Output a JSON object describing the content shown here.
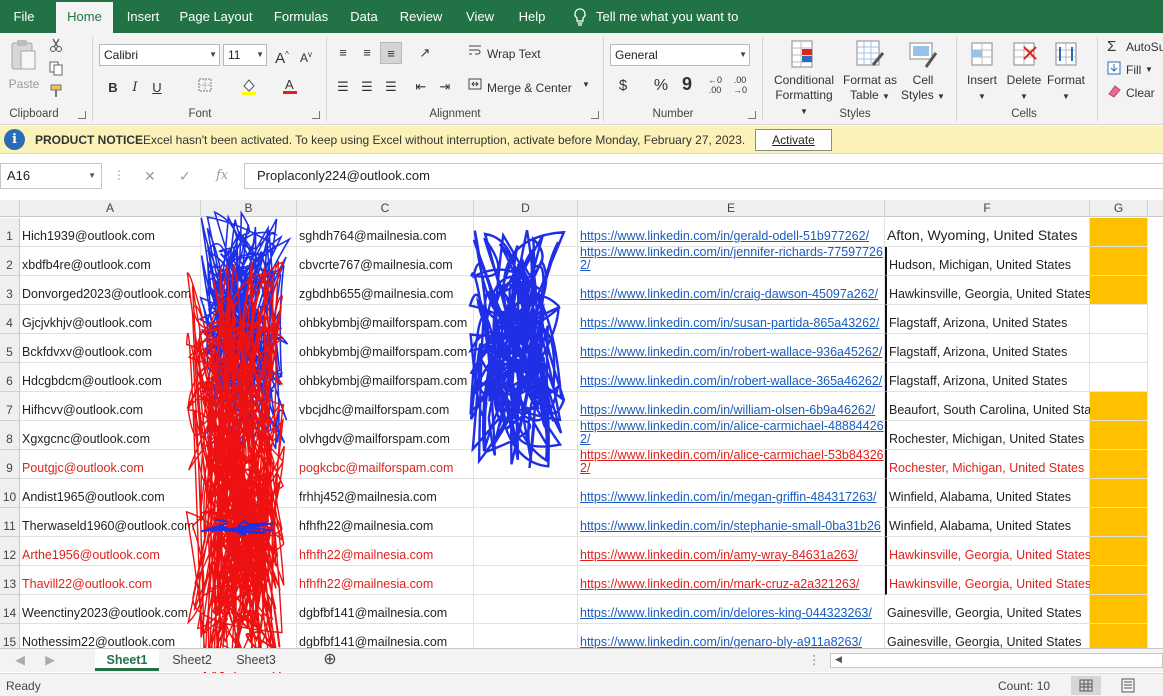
{
  "ribbon_tabs": [
    "File",
    "Home",
    "Insert",
    "Page Layout",
    "Formulas",
    "Data",
    "Review",
    "View",
    "Help"
  ],
  "active_tab": "Home",
  "tell_me": "Tell me what you want to do",
  "clipboard": {
    "paste": "Paste",
    "group": "Clipboard"
  },
  "font": {
    "name": "Calibri",
    "size": "11",
    "bold": "B",
    "italic": "I",
    "underline": "U",
    "group": "Font",
    "grow": "A",
    "shrink": "A"
  },
  "alignment": {
    "wrap_text": "Wrap Text",
    "merge_center": "Merge & Center",
    "group": "Alignment"
  },
  "number": {
    "format": "General",
    "currency": "$",
    "percent": "%",
    "comma": "9",
    "group": "Number"
  },
  "styles": {
    "conditional": [
      "Conditional",
      "Formatting"
    ],
    "format_table": [
      "Format as",
      "Table"
    ],
    "cell_styles": [
      "Cell",
      "Styles"
    ],
    "group": "Styles"
  },
  "cells": {
    "insert": "Insert",
    "delete": "Delete",
    "format": "Format",
    "group": "Cells"
  },
  "editing": {
    "autosum": "AutoSu",
    "fill": "Fill",
    "clear": "Clear"
  },
  "notice": {
    "title": "PRODUCT NOTICE",
    "message": "Excel hasn't been activated. To keep using Excel without interruption, activate before Monday, February 27, 2023.",
    "button": "Activate"
  },
  "formula_bar": {
    "cell_ref": "A16",
    "value": "Proplaconly224@outlook.com"
  },
  "columns": [
    "A",
    "B",
    "C",
    "D",
    "E",
    "F",
    "G"
  ],
  "rows": [
    {
      "n": "1",
      "a": "Hich1939@outlook.com",
      "c": "sghdh764@mailnesia.com",
      "e": "https://www.linkedin.com/in/gerald-odell-51b977262/",
      "f": "Afton, Wyoming, United States",
      "red": false,
      "g_fill": true
    },
    {
      "n": "2",
      "a": "xbdfb4re@outlook.com",
      "c": "cbvcrte767@mailnesia.com",
      "e": "https://www.linkedin.com/in/jennifer-richards-775977262/",
      "f": "Hudson, Michigan, United States",
      "red": false,
      "g_fill": true
    },
    {
      "n": "3",
      "a": "Donvorged2023@outlook.com",
      "c": "zgbdhb655@mailnesia.com",
      "e": "https://www.linkedin.com/in/craig-dawson-45097a262/",
      "f": "Hawkinsville, Georgia, United States",
      "red": false,
      "g_fill": true
    },
    {
      "n": "4",
      "a": "Gjcjvkhjv@outlook.com",
      "c": "ohbkybmbj@mailforspam.com",
      "e": "https://www.linkedin.com/in/susan-partida-865a43262/",
      "f": "Flagstaff, Arizona, United States",
      "red": false,
      "g_fill": false
    },
    {
      "n": "5",
      "a": "Bckfdvxv@outlook.com",
      "c": "ohbkybmbj@mailforspam.com",
      "e": "https://www.linkedin.com/in/robert-wallace-936a45262/",
      "f": "Flagstaff, Arizona, United States",
      "red": false,
      "g_fill": false
    },
    {
      "n": "6",
      "a": "Hdcgbdcm@outlook.com",
      "c": "ohbkybmbj@mailforspam.com",
      "e": "https://www.linkedin.com/in/robert-wallace-365a46262/",
      "f": "Flagstaff, Arizona, United States",
      "red": false,
      "g_fill": false
    },
    {
      "n": "7",
      "a": "Hifhcvv@outlook.com",
      "c": "vbcjdhc@mailforspam.com",
      "e": "https://www.linkedin.com/in/william-olsen-6b9a46262/",
      "f": "Beaufort, South Carolina, United States",
      "red": false,
      "g_fill": true
    },
    {
      "n": "8",
      "a": "Xgxgcnc@outlook.com",
      "c": "olvhgdv@mailforspam.com",
      "e": "https://www.linkedin.com/in/alice-carmichael-488844262/",
      "f": "Rochester, Michigan, United States",
      "red": false,
      "g_fill": true
    },
    {
      "n": "9",
      "a": "Poutgjc@outlook.com",
      "c": "pogkcbc@mailforspam.com",
      "e": "https://www.linkedin.com/in/alice-carmichael-53b843262/",
      "f": "Rochester, Michigan, United States",
      "red": true,
      "g_fill": true
    },
    {
      "n": "10",
      "a": "Andist1965@outlook.com",
      "c": "frhhj452@mailnesia.com",
      "e": "https://www.linkedin.com/in/megan-griffin-484317263/",
      "f": "Winfield, Alabama, United States",
      "red": false,
      "g_fill": true
    },
    {
      "n": "11",
      "a": "Therwaseld1960@outlook.com",
      "c": "hfhfh22@mailnesia.com",
      "e": "https://www.linkedin.com/in/stephanie-small-0ba31b26",
      "f": "Winfield, Alabama, United States",
      "red": false,
      "g_fill": true
    },
    {
      "n": "12",
      "a": "Arthe1956@outlook.com",
      "c": "hfhfh22@mailnesia.com",
      "e": "https://www.linkedin.com/in/amy-wray-84631a263/",
      "f": "Hawkinsville, Georgia, United States",
      "red": true,
      "g_fill": true
    },
    {
      "n": "13",
      "a": "Thavill22@outlook.com",
      "c": "hfhfh22@mailnesia.com",
      "e": "https://www.linkedin.com/in/mark-cruz-a2a321263/",
      "f": "Hawkinsville, Georgia, United States",
      "red": true,
      "g_fill": true
    },
    {
      "n": "14",
      "a": "Weenctiny2023@outlook.com",
      "c": "dgbfbf141@mailnesia.com",
      "e": "https://www.linkedin.com/in/delores-king-044323263/",
      "f": "Gainesville, Georgia, United States",
      "red": false,
      "g_fill": true
    },
    {
      "n": "15",
      "a": "Nothessim22@outlook.com",
      "c": "dgbfbf141@mailnesia.com",
      "e": "https://www.linkedin.com/in/genaro-bly-a911a8263/",
      "f": "Gainesville, Georgia, United States",
      "red": false,
      "g_fill": true
    }
  ],
  "sheets": [
    "Sheet1",
    "Sheet2",
    "Sheet3"
  ],
  "active_sheet": "Sheet1",
  "status": {
    "ready": "Ready",
    "count": "Count: 10"
  },
  "colors": {
    "excel_green": "#217346",
    "highlight": "#ffc000",
    "red_text": "#e0211c",
    "link": "#1a5cbf",
    "scribble_blue": "#1f2fe6",
    "scribble_red": "#ee1111"
  }
}
